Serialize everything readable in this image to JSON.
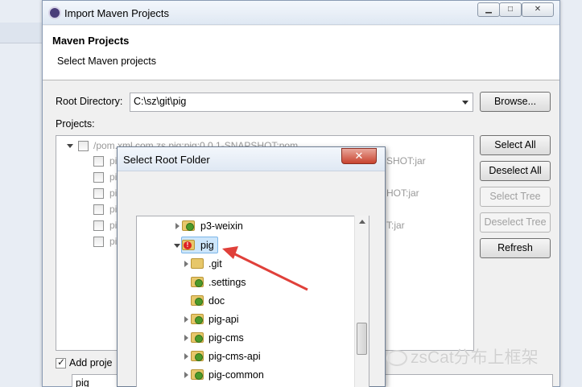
{
  "main_dialog": {
    "title": "Import Maven Projects",
    "header_title": "Maven Projects",
    "header_subtitle": "Select Maven projects",
    "root_directory_label": "Root Directory:",
    "root_directory_value": "C:\\sz\\git\\pig",
    "browse_label": "Browse...",
    "projects_label": "Projects:",
    "project_rows": [
      "/pom.xml   com.zs.pig:pig:0.0.1-SNAPSHOT:pom",
      "pi",
      "pi",
      "pi",
      "pi",
      "pi",
      "pi"
    ],
    "project_row_suffixes": [
      "SHOT:jar",
      "HOT:jar",
      "T:jar"
    ],
    "side_buttons": {
      "select_all": "Select All",
      "deselect_all": "Deselect All",
      "select_tree": "Select Tree",
      "deselect_tree": "Deselect Tree",
      "refresh": "Refresh"
    },
    "add_project_label": "Add proje",
    "working_set_value": "pig"
  },
  "root_folder_dialog": {
    "title": "Select Root Folder",
    "close_glyph": "✕",
    "tree": [
      {
        "label": "p3-weixin",
        "state": "ok"
      },
      {
        "label": "pig",
        "state": "error"
      },
      {
        "label": ".git",
        "state": "plain"
      },
      {
        "label": ".settings",
        "state": "ok"
      },
      {
        "label": "doc",
        "state": "ok"
      },
      {
        "label": "pig-api",
        "state": "ok"
      },
      {
        "label": "pig-cms",
        "state": "ok"
      },
      {
        "label": "pig-cms-api",
        "state": "ok"
      },
      {
        "label": "pig-common",
        "state": "ok"
      }
    ]
  },
  "watermark": "zsCat分布上框架",
  "colors": {
    "arrow": "#e0403a",
    "selection": "#cde6fb",
    "titlebar": "#dfe8f3"
  }
}
